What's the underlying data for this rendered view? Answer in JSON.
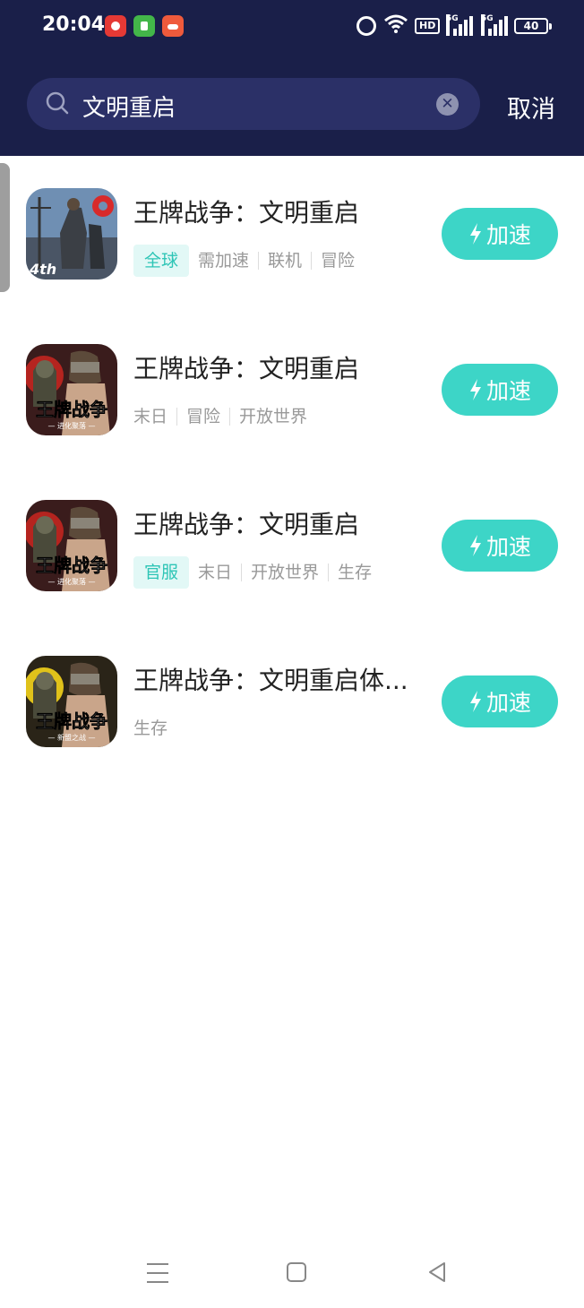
{
  "status_bar": {
    "time": "20:04",
    "network_hd": "HD",
    "network_1": "5G",
    "network_2": "5G",
    "battery": "40",
    "icons": [
      "video-app-icon",
      "green-app-icon",
      "shop-app-icon",
      "alarm-icon",
      "wifi-icon"
    ]
  },
  "search": {
    "query": "文明重启",
    "cancel_label": "取消"
  },
  "colors": {
    "header_bg": "#1a1f49",
    "accent": "#3dd5c7",
    "tag_highlight_text": "#2ec5b6"
  },
  "results": [
    {
      "title": "王牌战争：文明重启",
      "icon": "game-cover-4th-icon",
      "tags": [
        {
          "label": "全球",
          "highlight": true
        },
        {
          "label": "需加速",
          "highlight": false
        },
        {
          "label": "联机",
          "highlight": false
        },
        {
          "label": "冒险",
          "highlight": false
        }
      ],
      "button": "加速"
    },
    {
      "title": "王牌战争：文明重启",
      "icon": "game-cover-red-icon",
      "icon_text": "王牌战争",
      "icon_sub": "— 进化聚落 —",
      "tags": [
        {
          "label": "末日",
          "highlight": false
        },
        {
          "label": "冒险",
          "highlight": false
        },
        {
          "label": "开放世界",
          "highlight": false
        }
      ],
      "button": "加速"
    },
    {
      "title": "王牌战争：文明重启",
      "icon": "game-cover-red-icon",
      "icon_text": "王牌战争",
      "icon_sub": "— 进化聚落 —",
      "tags": [
        {
          "label": "官服",
          "highlight": true
        },
        {
          "label": "末日",
          "highlight": false
        },
        {
          "label": "开放世界",
          "highlight": false
        },
        {
          "label": "生存",
          "highlight": false
        }
      ],
      "button": "加速"
    },
    {
      "title": "王牌战争：文明重启体...",
      "icon": "game-cover-yellow-icon",
      "icon_text": "王牌战争",
      "icon_sub": "— 新盟之战 —",
      "tags": [
        {
          "label": "生存",
          "highlight": false
        }
      ],
      "button": "加速"
    }
  ]
}
